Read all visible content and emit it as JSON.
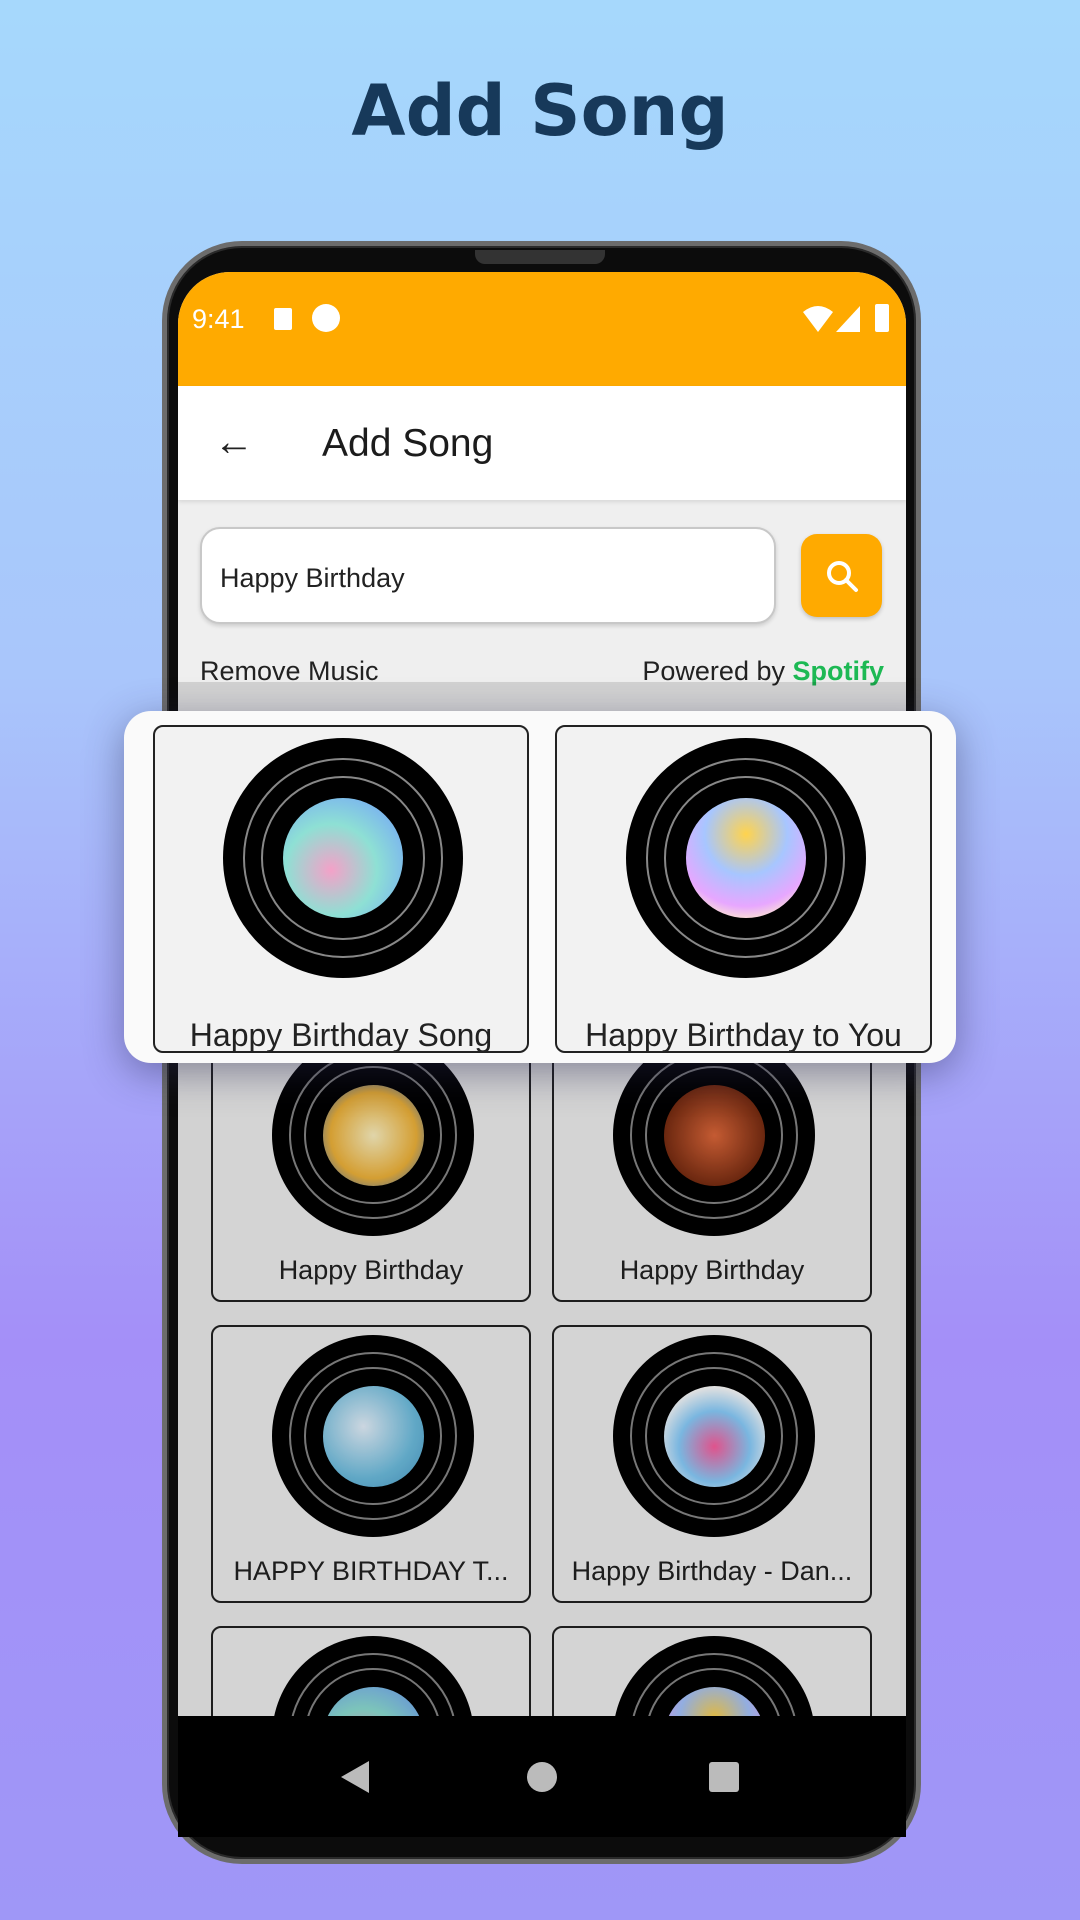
{
  "hero_title": "Add Song",
  "status_bar": {
    "time": "9:41"
  },
  "app_bar": {
    "title": "Add Song",
    "back_icon": "arrow-left-icon"
  },
  "search": {
    "value": "Happy Birthday",
    "button_icon": "search-icon"
  },
  "remove_music_label": "Remove Music",
  "powered_by": {
    "prefix": "Powered by",
    "brand": "Spotify",
    "brand_color": "#1db954"
  },
  "accent_color": "#ffaa00",
  "highlighted_songs": [
    {
      "title": "Happy Birthday Song"
    },
    {
      "title": "Happy Birthday to You"
    }
  ],
  "songs": [
    {
      "title": "Happy Birthday"
    },
    {
      "title": "Happy Birthday"
    },
    {
      "title": "HAPPY BIRTHDAY T..."
    },
    {
      "title": "Happy Birthday - Dan..."
    }
  ],
  "nav_bar": {
    "back": "triangle-back-icon",
    "home": "circle-home-icon",
    "recents": "square-recents-icon"
  }
}
